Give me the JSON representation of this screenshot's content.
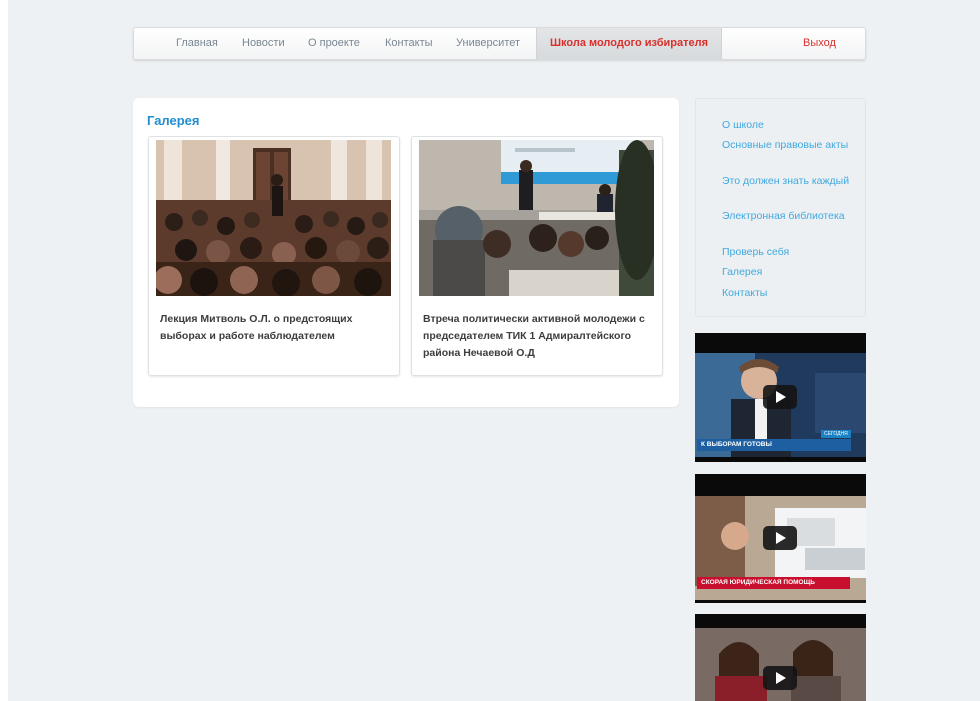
{
  "nav": {
    "items": [
      "Главная",
      "Новости",
      "О проекте",
      "Контакты",
      "Университет"
    ],
    "active": "Школа молодого избирателя",
    "logout": "Выход"
  },
  "gallery": {
    "title": "Галерея",
    "cards": [
      {
        "caption": "Лекция Митволь О.Л. о предстоящих выборах и работе наблюдателем"
      },
      {
        "caption": "Втреча политически активной молодежи с председателем ТИК 1 Адмиралтейского района Нечаевой О.Д"
      }
    ]
  },
  "sidebar": {
    "items": [
      "О школе",
      "Основные правовые акты",
      "Это должен знать каждый",
      "Электронная библиотека",
      "Проверь себя",
      "Галерея",
      "Контакты"
    ]
  },
  "videos": [
    {
      "overlay": "К ВЫБОРАМ ГОТОВЫ",
      "tag": "СЕГОДНЯ"
    },
    {
      "overlay": "СКОРАЯ ЮРИДИЧЕСКАЯ ПОМОЩЬ",
      "tag": ""
    },
    {
      "overlay": "",
      "tag": ""
    }
  ],
  "colors": {
    "accent_blue": "#1f8fd1",
    "link_blue": "#3fa9e0",
    "active_red": "#d9302b",
    "background": "#eef1f3"
  },
  "icons": {
    "video_play": "play-icon"
  }
}
